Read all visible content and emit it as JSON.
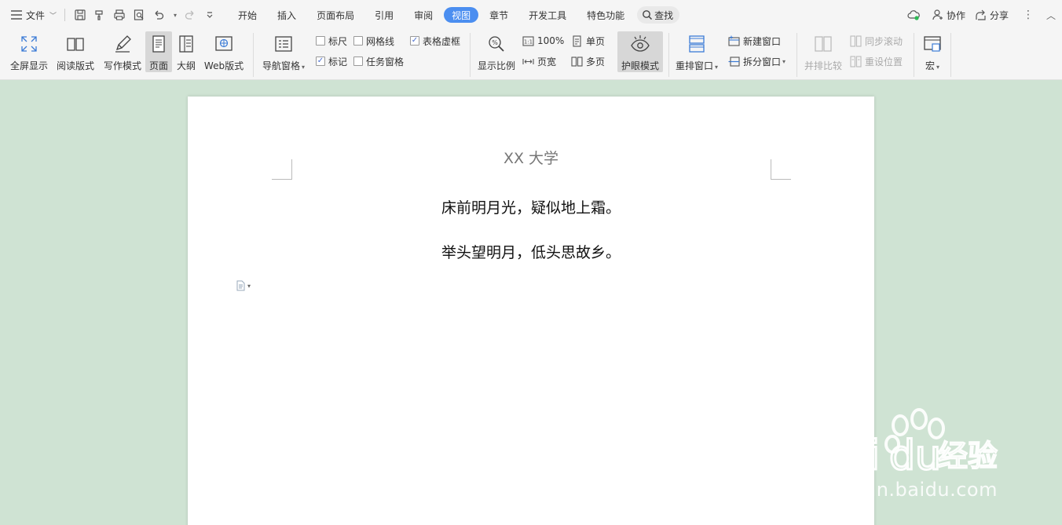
{
  "menubar": {
    "file_label": "文件",
    "tabs": [
      {
        "label": "开始",
        "active": false
      },
      {
        "label": "插入",
        "active": false
      },
      {
        "label": "页面布局",
        "active": false
      },
      {
        "label": "引用",
        "active": false
      },
      {
        "label": "审阅",
        "active": false
      },
      {
        "label": "视图",
        "active": true
      },
      {
        "label": "章节",
        "active": false
      },
      {
        "label": "开发工具",
        "active": false
      },
      {
        "label": "特色功能",
        "active": false
      }
    ],
    "search_label": "查找",
    "collab_label": "协作",
    "share_label": "分享",
    "active_tab_color": "#4b8ef0"
  },
  "ribbon": {
    "fullscreen": "全屏显示",
    "reading": "阅读版式",
    "writing": "写作模式",
    "page": "页面",
    "outline": "大纲",
    "web": "Web版式",
    "nav_pane": "导航窗格",
    "ruler": {
      "label": "标尺",
      "checked": false
    },
    "gridlines": {
      "label": "网格线",
      "checked": false
    },
    "table_gridlines": {
      "label": "表格虚框",
      "checked": true
    },
    "marks": {
      "label": "标记",
      "checked": true
    },
    "task_pane": {
      "label": "任务窗格",
      "checked": false
    },
    "zoom": "显示比例",
    "zoom_100": "100%",
    "page_width": "页宽",
    "single_page": "单页",
    "multi_page": "多页",
    "eye_mode": "护眼模式",
    "arrange": "重排窗口",
    "new_window": "新建窗口",
    "split_window": "拆分窗口",
    "side_by_side": "并排比较",
    "sync_scroll": "同步滚动",
    "reset_position": "重设位置",
    "macro": "宏"
  },
  "document": {
    "header": "XX 大学",
    "lines": [
      "床前明月光，疑似地上霜。",
      "举头望明月，低头思故乡。"
    ]
  },
  "watermark": {
    "brand": "Baidu经验",
    "url": "jingyan.baidu.com"
  },
  "colors": {
    "background": "#cfe3d3",
    "toolbar": "#f5f5f5",
    "accent": "#4b8ef0"
  }
}
